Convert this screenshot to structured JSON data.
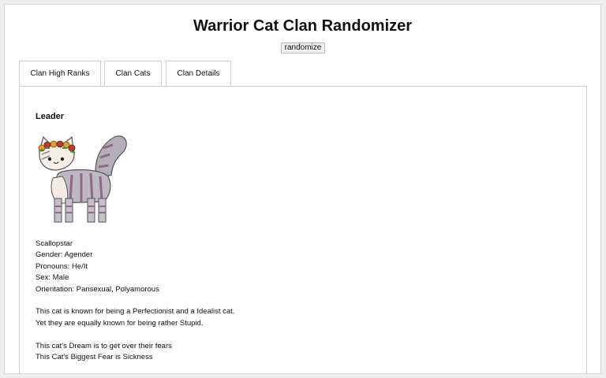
{
  "title": "Warrior Cat Clan Randomizer",
  "randomize_label": "randomize",
  "tabs": [
    {
      "label": "Clan High Ranks",
      "active": true
    },
    {
      "label": "Clan Cats",
      "active": false
    },
    {
      "label": "Clan Details",
      "active": false
    }
  ],
  "panel": {
    "heading": "Leader",
    "cat_image": "cat-sprite-flower-crown",
    "name": "Scallopstar",
    "gender": "Gender: Agender",
    "pronouns": "Pronouns: He/It",
    "sex": "Sex: Male",
    "orientation": "Orientation: Pansexual, Polyamorous",
    "trait_line1": "This cat is known for being a Perfectionist and a Idealist cat.",
    "trait_line2": "Yet they are equally known for being rather Stupid.",
    "dream": "This cat's Dream is to get over their fears",
    "fear": "This Cat's Biggest Fear is Sickness"
  }
}
